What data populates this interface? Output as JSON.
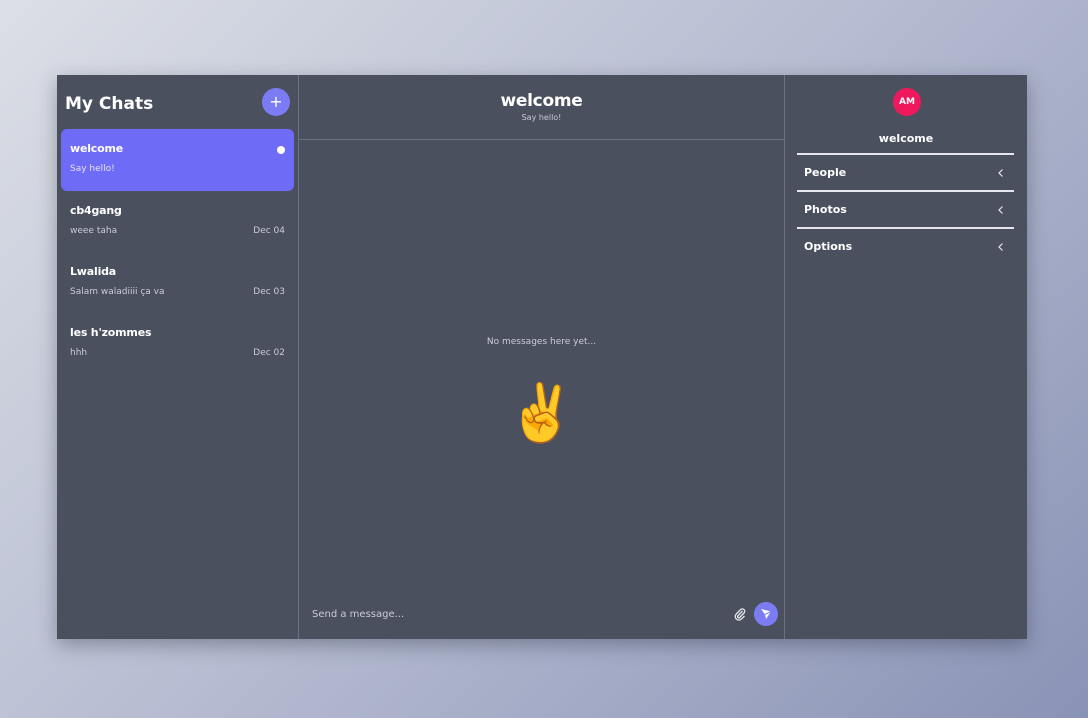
{
  "left": {
    "title": "My Chats",
    "add_label": "+",
    "chats": [
      {
        "name": "welcome",
        "last": "Say hello!",
        "date": "",
        "active": true
      },
      {
        "name": "cb4gang",
        "last": "weee taha",
        "date": "Dec 04",
        "active": false
      },
      {
        "name": "Lwalida",
        "last": "Salam waladiiii ça va",
        "date": "Dec 03",
        "active": false
      },
      {
        "name": "les h'zommes",
        "last": "hhh",
        "date": "Dec 02",
        "active": false
      }
    ]
  },
  "mid": {
    "title": "welcome",
    "subtitle": "Say hello!",
    "empty_text": "No messages here yet...",
    "emoji": "✌️",
    "input_placeholder": "Send a message..."
  },
  "right": {
    "avatar_initials": "AM",
    "title": "welcome",
    "sections": [
      "People",
      "Photos",
      "Options"
    ]
  },
  "colors": {
    "accent": "#7b7cf4",
    "active_chat": "#6e6bf6",
    "avatar": "#f0185c",
    "panel": "#4b505f"
  }
}
